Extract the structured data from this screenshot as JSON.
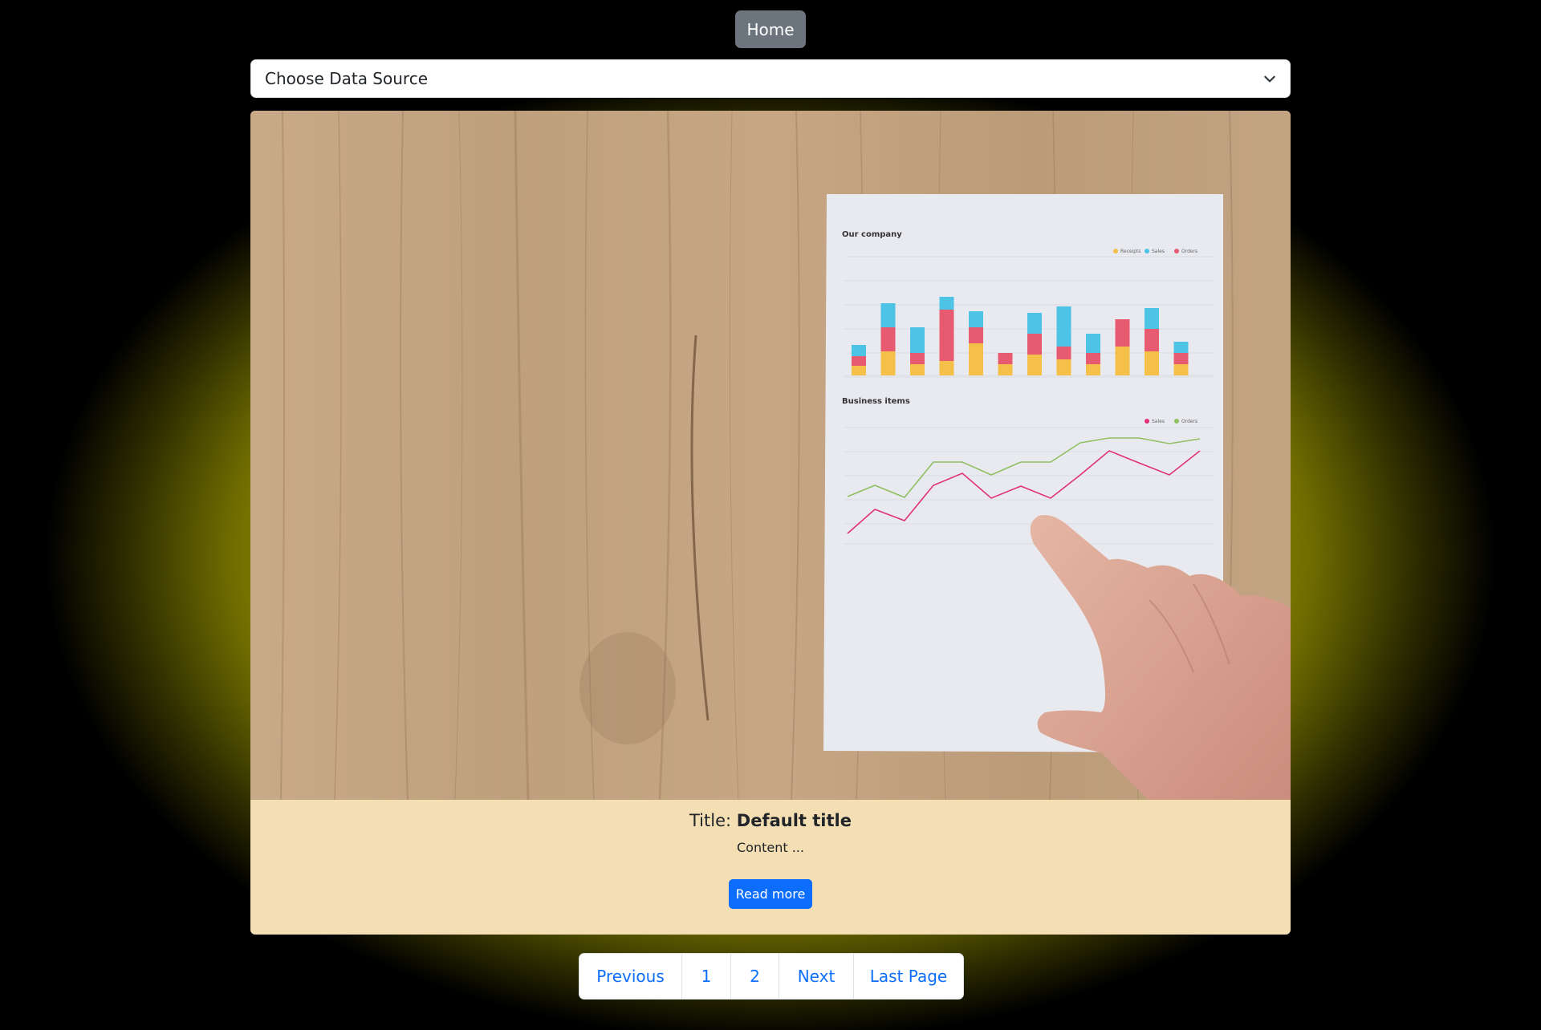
{
  "nav": {
    "home_label": "Home"
  },
  "data_source": {
    "selected": "Choose Data Source"
  },
  "card": {
    "title_prefix": "Title:",
    "title_value": "Default title",
    "content": "Content ...",
    "read_more_label": "Read more",
    "image": {
      "chart1_title": "Our company",
      "chart1_legend": [
        "Receipts",
        "Sales",
        "Orders"
      ],
      "chart2_title": "Business items",
      "chart2_legend": [
        "Sales",
        "Orders"
      ]
    }
  },
  "pagination": {
    "previous": "Previous",
    "pages": [
      "1",
      "2"
    ],
    "next": "Next",
    "last": "Last Page"
  },
  "colors": {
    "accent": "#0d6efd",
    "home_button": "#6c757d",
    "card_body": "#f4deb3",
    "glow": "#a3a000"
  }
}
